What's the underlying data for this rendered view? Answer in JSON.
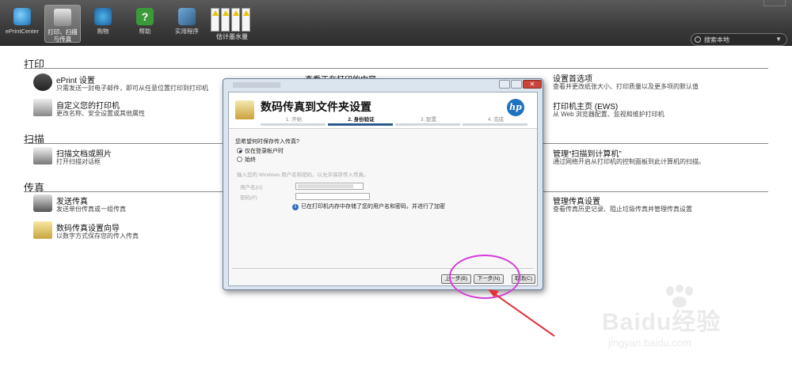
{
  "toolbar": {
    "buttons": [
      {
        "label": "ePrintCenter"
      },
      {
        "label": "打印、扫描与传真"
      },
      {
        "label": "购物"
      },
      {
        "label": "帮助"
      },
      {
        "label": "实用程序"
      }
    ],
    "ink_label": "估计墨水量",
    "search_placeholder": "搜索本地"
  },
  "sections": {
    "print": "打印",
    "scan": "扫描",
    "fax": "传真"
  },
  "items": {
    "eprint": {
      "title": "ePrint 设置",
      "desc": "只需发送一封电子邮件，即可从任意位置打印到打印机"
    },
    "view_printing": {
      "title": "查看正在打印的内容"
    },
    "customize": {
      "title": "自定义您的打印机",
      "desc": "更改名称、安全设置或其他属性"
    },
    "prefs": {
      "title": "设置首选项",
      "desc": "查看并更改纸张大小、打印质量以及更多项的默认值"
    },
    "ews": {
      "title": "打印机主页 (EWS)",
      "desc": "从 Web 浏览器配置、监视和维护打印机"
    },
    "scan_doc": {
      "title": "扫描文档或照片",
      "desc": "打开扫描对话框"
    },
    "scan_to_pc": {
      "title": "管理“扫描到计算机”",
      "desc": "通过网络开启从打印机的控制面板到此计算机的扫描。"
    },
    "send_fax": {
      "title": "发送传真",
      "desc": "发送单份传真或一组传真"
    },
    "fax_wizard": {
      "title": "数码传真设置向导",
      "desc": "以数字方式保存您的传入传真"
    },
    "fax_settings": {
      "title": "管理传真设置",
      "desc": "查看传真历史记录、阻止垃圾传真并管理传真设置"
    }
  },
  "dialog": {
    "title": "数码传真到文件夹设置",
    "steps": [
      "1. 开始",
      "2. 身份验证",
      "3. 配置",
      "4. 完成"
    ],
    "active_step": 1,
    "question": "您希望何时保存传入传真?",
    "options": [
      "仅在登录帐户时",
      "始终"
    ],
    "selected_option": 0,
    "credential_hint": "输入您的 Windows 用户名和密码，以允许保存传入传真。",
    "username_label": "用户名(U)",
    "password_label": "密码(P)",
    "info_text": "已在打印机内存中存储了您的用户名和密码，并进行了加密",
    "buttons": {
      "back": "上一步(B)",
      "next": "下一步(N)",
      "cancel": "取消(C)"
    }
  },
  "watermark": {
    "brand": "Baidu经验",
    "url": "jingyan.baidu.com"
  },
  "colors": {
    "annotation_ellipse": "#d43cd9",
    "annotation_arrow": "#e2323a",
    "hp_blue": "#1e73be"
  }
}
